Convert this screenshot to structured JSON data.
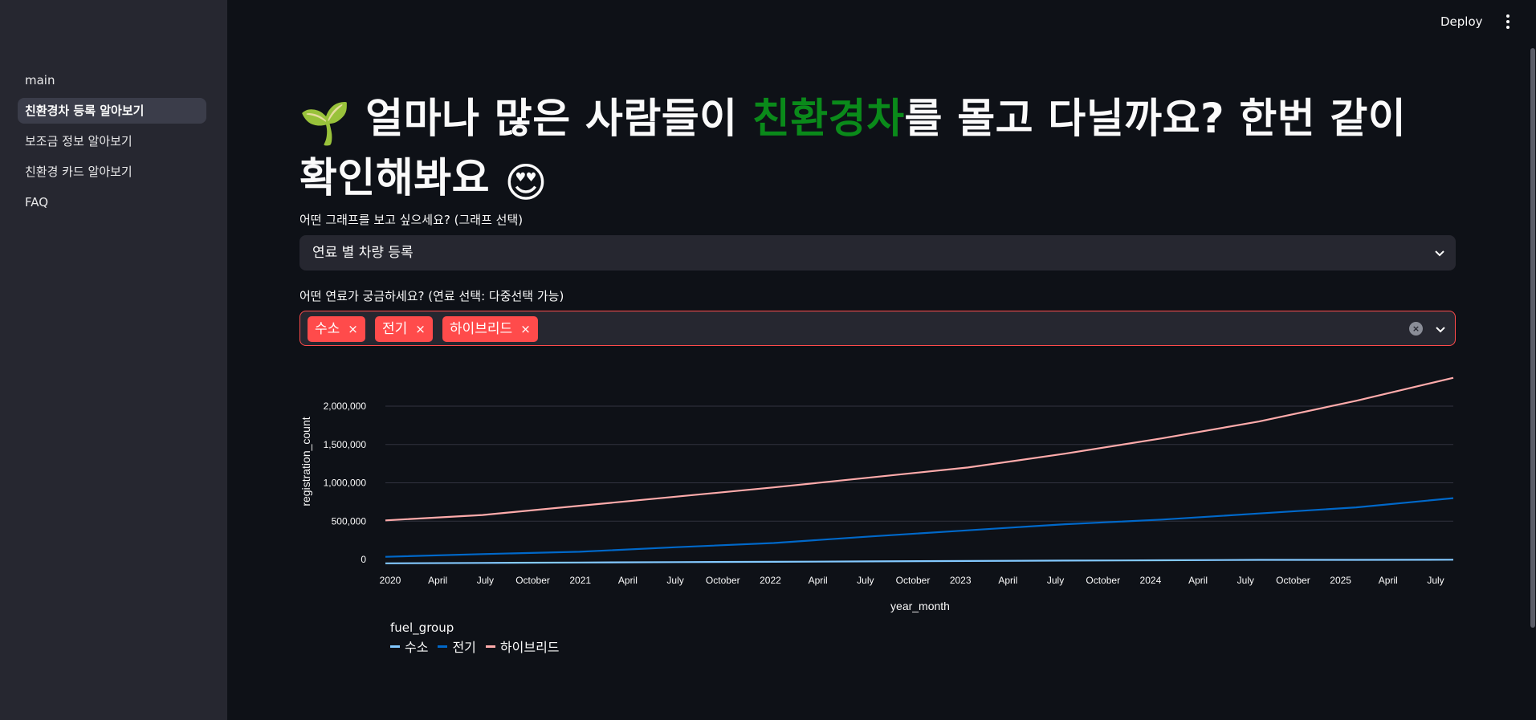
{
  "sidebar": {
    "items": [
      {
        "label": "main",
        "active": false
      },
      {
        "label": "친환경차 등록 알아보기",
        "active": true
      },
      {
        "label": "보조금 정보 알아보기",
        "active": false
      },
      {
        "label": "친환경 카드 알아보기",
        "active": false
      },
      {
        "label": "FAQ",
        "active": false
      }
    ]
  },
  "header": {
    "deploy_label": "Deploy",
    "menu_icon": "kebab-menu-icon"
  },
  "main": {
    "title_emoji_start": "🌱",
    "title_part1": "얼마나 많은 사람들이 ",
    "title_highlight": "친환경차",
    "title_part2": "를 몰고 다닐까요? 한번 같이 확인해봐요",
    "title_emoji_end": "😍",
    "highlight_color": "#0a8a1a",
    "graph_select": {
      "label": "어떤 그래프를 보고 싶으세요? (그래프 선택)",
      "value": "연료 별 차량 등록"
    },
    "fuel_select": {
      "label": "어떤 연료가 궁금하세요? (연료 선택: 다중선택 가능)",
      "tags": [
        "수소",
        "전기",
        "하이브리드"
      ],
      "tag_remove_symbol": "×",
      "clear_symbol": "×"
    }
  },
  "chart_data": {
    "type": "line",
    "xlabel": "year_month",
    "ylabel": "registration_count",
    "x": [
      "2020-01",
      "2020-07",
      "2021-01",
      "2021-07",
      "2022-01",
      "2022-07",
      "2023-01",
      "2023-07",
      "2024-01",
      "2024-07",
      "2025-01",
      "2025-07"
    ],
    "x_tick_labels": [
      "2020",
      "April",
      "July",
      "October",
      "2021",
      "April",
      "July",
      "October",
      "2022",
      "April",
      "July",
      "October",
      "2023",
      "April",
      "July",
      "October",
      "2024",
      "April",
      "July",
      "October",
      "2025",
      "April",
      "July"
    ],
    "y_tick_labels": [
      "0",
      "500,000",
      "1,000,000",
      "1,500,000",
      "2,000,000"
    ],
    "ylim": [
      -70000,
      2400000
    ],
    "legend_title": "fuel_group",
    "legend_position": "bottom-left",
    "grid": true,
    "series": [
      {
        "name": "수소",
        "color": "#83c9ff",
        "values": [
          -50000,
          -45000,
          -40000,
          -35000,
          -30000,
          -25000,
          -20000,
          -15000,
          -10000,
          -5000,
          -5000,
          -3000
        ]
      },
      {
        "name": "전기",
        "color": "#0068c9",
        "values": [
          35000,
          70000,
          100000,
          160000,
          215000,
          300000,
          380000,
          460000,
          520000,
          600000,
          680000,
          800000
        ]
      },
      {
        "name": "하이브리드",
        "color": "#ffabab",
        "values": [
          510000,
          580000,
          700000,
          820000,
          940000,
          1070000,
          1200000,
          1380000,
          1580000,
          1800000,
          2070000,
          2370000
        ]
      }
    ]
  }
}
